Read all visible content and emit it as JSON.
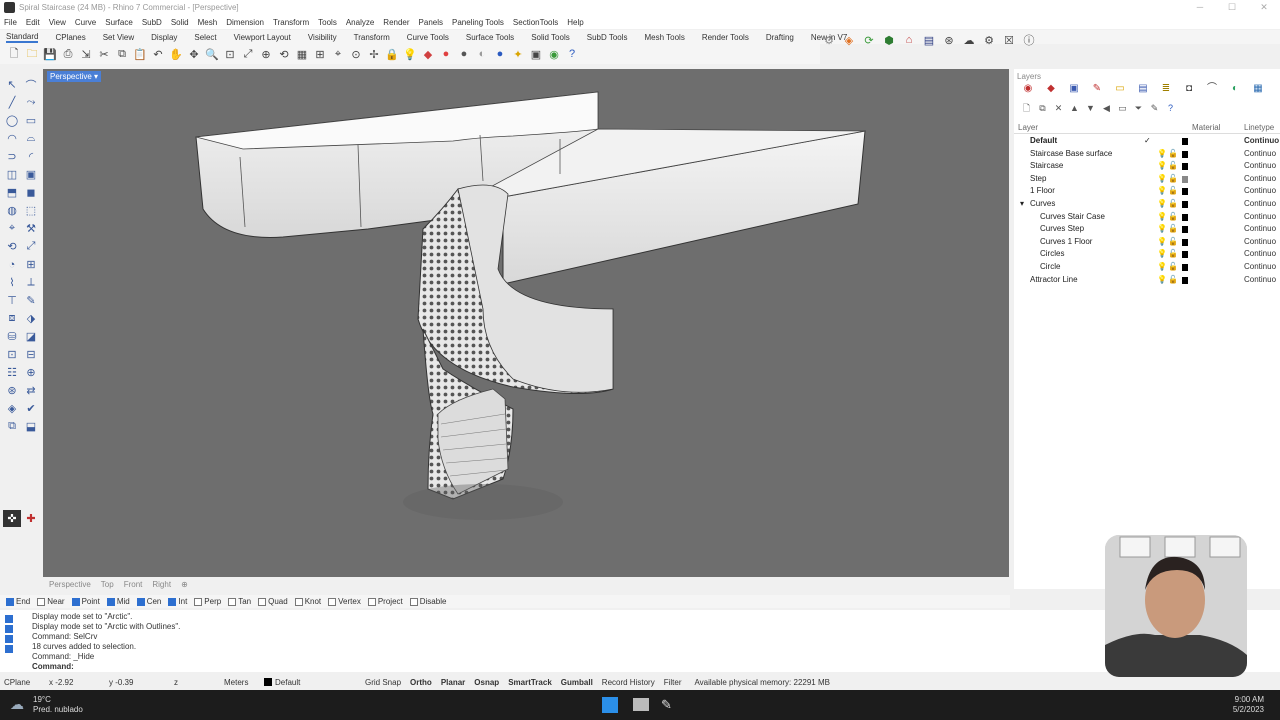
{
  "window": {
    "title": "Spiral Staircase (24 MB) - Rhino 7 Commercial - [Perspective]"
  },
  "menu": [
    "File",
    "Edit",
    "View",
    "Curve",
    "Surface",
    "SubD",
    "Solid",
    "Mesh",
    "Dimension",
    "Transform",
    "Tools",
    "Analyze",
    "Render",
    "Panels",
    "Paneling Tools",
    "SectionTools",
    "Help"
  ],
  "toolbar_tabs": [
    "Standard",
    "CPlanes",
    "Set View",
    "Display",
    "Select",
    "Viewport Layout",
    "Visibility",
    "Transform",
    "Curve Tools",
    "Surface Tools",
    "Solid Tools",
    "SubD Tools",
    "Mesh Tools",
    "Render Tools",
    "Drafting",
    "New in V7"
  ],
  "viewport": {
    "label": "Perspective"
  },
  "view_tabs": [
    "Perspective",
    "Top",
    "Front",
    "Right"
  ],
  "osnaps": [
    {
      "label": "End",
      "checked": true
    },
    {
      "label": "Near",
      "checked": false
    },
    {
      "label": "Point",
      "checked": true
    },
    {
      "label": "Mid",
      "checked": true
    },
    {
      "label": "Cen",
      "checked": true
    },
    {
      "label": "Int",
      "checked": true
    },
    {
      "label": "Perp",
      "checked": false
    },
    {
      "label": "Tan",
      "checked": false
    },
    {
      "label": "Quad",
      "checked": false
    },
    {
      "label": "Knot",
      "checked": false
    },
    {
      "label": "Vertex",
      "checked": false
    },
    {
      "label": "Project",
      "checked": false
    },
    {
      "label": "Disable",
      "checked": false
    }
  ],
  "command_history": [
    "Display mode set to \"Arctic\".",
    "Display mode set to \"Arctic with Outlines\".",
    "Command: SelCrv",
    "18 curves added to selection.",
    "Command: _Hide",
    "Command:"
  ],
  "command_side_labels": [
    "P",
    "C",
    "S",
    "P"
  ],
  "status": {
    "cplane": "CPlane",
    "x": "x -2.92",
    "y": "y -0.39",
    "z": "z",
    "units": "Meters",
    "layer": "Default",
    "toggles": [
      "Grid Snap",
      "Ortho",
      "Planar",
      "Osnap",
      "SmartTrack",
      "Gumball",
      "Record History",
      "Filter"
    ],
    "memory": "Available physical memory: 22291 MB"
  },
  "layers_panel": {
    "title": "Layers",
    "columns": [
      "Layer",
      "Material",
      "Linetype"
    ],
    "rows": [
      {
        "name": "Default",
        "indent": 0,
        "bold": true,
        "current": true,
        "linetype": "Continuo"
      },
      {
        "name": "Staircase Base surface",
        "indent": 0,
        "linetype": "Continuo"
      },
      {
        "name": "Staircase",
        "indent": 0,
        "linetype": "Continuo"
      },
      {
        "name": "Step",
        "indent": 0,
        "linetype": "Continuo",
        "color": "#888888"
      },
      {
        "name": "1 Floor",
        "indent": 0,
        "linetype": "Continuo"
      },
      {
        "name": "Curves",
        "indent": 0,
        "expand": true,
        "linetype": "Continuo"
      },
      {
        "name": "Curves Stair Case",
        "indent": 1,
        "linetype": "Continuo"
      },
      {
        "name": "Curves Step",
        "indent": 1,
        "linetype": "Continuo"
      },
      {
        "name": "Curves 1 Floor",
        "indent": 1,
        "linetype": "Continuo"
      },
      {
        "name": "Circles",
        "indent": 1,
        "linetype": "Continuo"
      },
      {
        "name": "Circle",
        "indent": 1,
        "linetype": "Continuo"
      },
      {
        "name": "Attractor Line",
        "indent": 0,
        "linetype": "Continuo"
      }
    ]
  },
  "taskbar": {
    "weather_temp": "19°C",
    "weather_desc": "Pred. nublado",
    "time": "9:00 AM",
    "date": "5/2/2023"
  },
  "colors": {
    "accent": "#2d6fd0",
    "viewport_bg": "#6e6e6e",
    "viewport_label": "#4a7fd6"
  }
}
